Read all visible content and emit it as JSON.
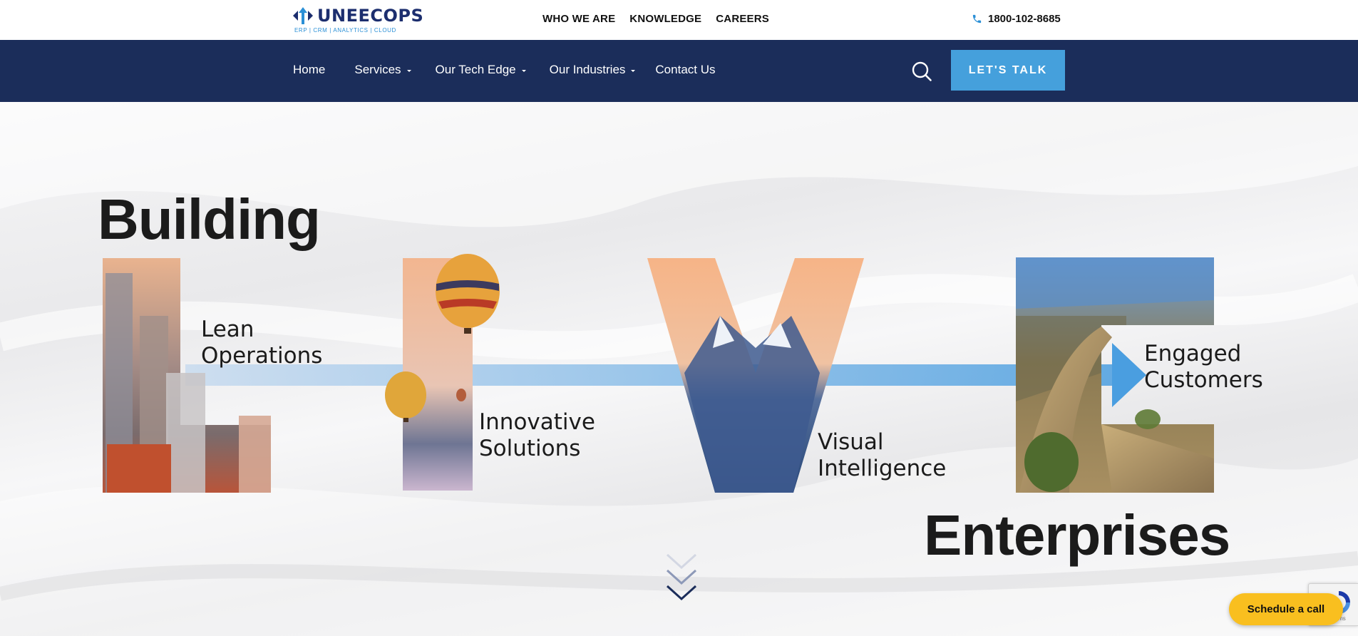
{
  "topbar": {
    "logo_text": "UNEECOPS",
    "logo_tagline": "ERP | CRM | ANALYTICS | CLOUD",
    "links": [
      "WHO WE ARE",
      "KNOWLEDGE",
      "CAREERS"
    ],
    "phone": "1800-102-8685"
  },
  "nav": {
    "items": [
      {
        "label": "Home",
        "dropdown": false
      },
      {
        "label": "Services",
        "dropdown": true
      },
      {
        "label": "Our Tech Edge",
        "dropdown": true
      },
      {
        "label": "Our Industries",
        "dropdown": true
      },
      {
        "label": "Contact Us",
        "dropdown": false
      }
    ],
    "cta": "LET'S TALK"
  },
  "hero": {
    "title_top": "Building",
    "title_bottom": "Enterprises",
    "captions": {
      "l1": "Lean",
      "l2": "Operations",
      "i1": "Innovative",
      "i2": "Solutions",
      "v1": "Visual",
      "v2": "Intelligence",
      "e1": "Engaged",
      "e2": "Customers"
    }
  },
  "schedule_call": "Schedule a call",
  "recaptcha_label": "Terms",
  "colors": {
    "navy": "#1b2d5a",
    "accent_blue": "#45a0dc",
    "arrow_blue": "#4a9ee0",
    "schedule_yellow": "#f9bf1f"
  },
  "icons": [
    "logo-mark-icon",
    "phone-icon",
    "search-icon",
    "chevron-down-icon",
    "recaptcha-icon"
  ]
}
